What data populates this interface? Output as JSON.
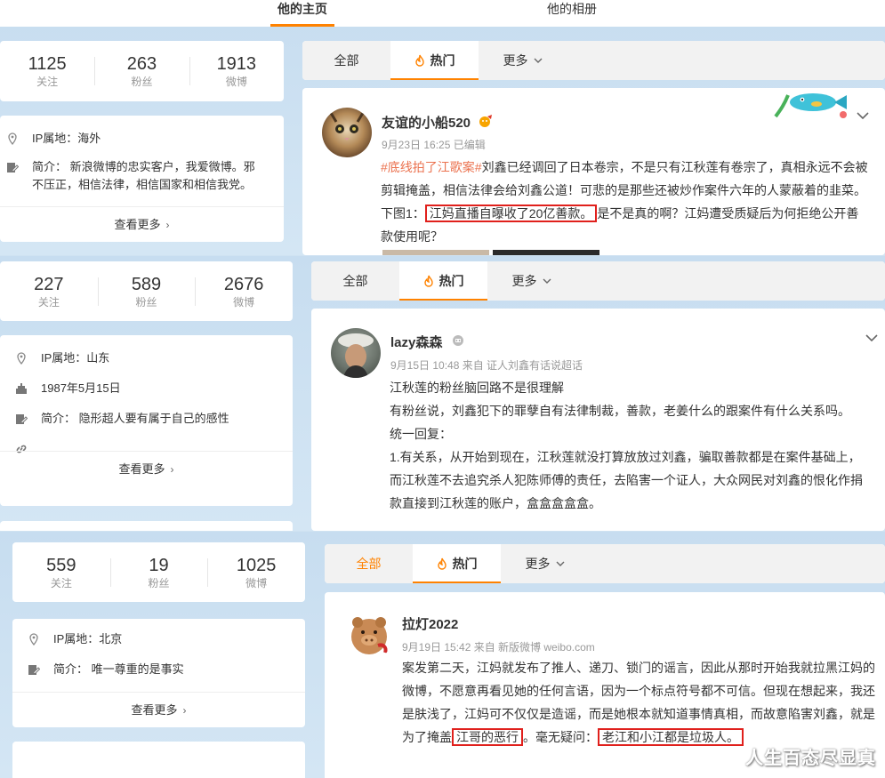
{
  "top_nav": {
    "tabs": [
      "他的主页",
      "他的相册"
    ]
  },
  "tabs": {
    "all": "全部",
    "hot": "热门",
    "more": "更多"
  },
  "more_label": "查看更多",
  "profiles": [
    {
      "stats": [
        {
          "value": "1125",
          "label": "关注"
        },
        {
          "value": "263",
          "label": "粉丝"
        },
        {
          "value": "1913",
          "label": "微博"
        }
      ],
      "ip": "IP属地：海外",
      "intro": "简介：  新浪微博的忠实客户，我爱微博。邪不压正，相信法律，相信国家和相信我党。"
    },
    {
      "stats": [
        {
          "value": "227",
          "label": "关注"
        },
        {
          "value": "589",
          "label": "粉丝"
        },
        {
          "value": "2676",
          "label": "微博"
        }
      ],
      "ip": "IP属地：山东",
      "birthday": "1987年5月15日",
      "intro": "简介：  隐形超人要有属于自己的感性"
    },
    {
      "stats": [
        {
          "value": "559",
          "label": "关注"
        },
        {
          "value": "19",
          "label": "粉丝"
        },
        {
          "value": "1025",
          "label": "微博"
        }
      ],
      "ip": "IP属地：北京",
      "intro": "简介：  唯一尊重的是事实"
    }
  ],
  "posts": [
    {
      "username": "友谊的小船520",
      "meta": "9月23日 16:25   已编辑",
      "tag": "#底线拍了江歌案#",
      "text_a": "刘鑫已经调回了日本卷宗，不是只有江秋莲有卷宗了，真相永远不会被剪辑掩盖，相信法律会给刘鑫公道！可悲的是那些还被炒作案件六年的人蒙蔽着的韭菜。下图1：",
      "highlight": "江妈直播自曝收了20亿善款。",
      "text_b": "是不是真的啊？江妈遭受质疑后为何拒绝公开善款使用呢？"
    },
    {
      "username": "lazy森森",
      "meta": "9月15日 10:48 来自 证人刘鑫有话说超话",
      "lines": [
        "江秋莲的粉丝脑回路不是很理解",
        "有粉丝说，刘鑫犯下的罪孽自有法律制裁，善款，老姜什么的跟案件有什么关系吗。",
        "统一回复：",
        "1.有关系，从开始到现在，江秋莲就没打算放放过刘鑫，骗取善款都是在案件基础上，而江秋莲不去追究杀人犯陈师傅的责任，去陷害一个证人，大众网民对刘鑫的恨化作捐款直接到江秋莲的账户，盒盒盒盒盒。"
      ]
    },
    {
      "username": "拉灯2022",
      "meta": "9月19日 15:42 来自 新版微博 weibo.com",
      "text_a": "案发第二天，江妈就发布了推人、递刀、锁门的谣言，因此从那时开始我就拉黑江妈的微博，不愿意再看见她的任何言语，因为一个标点符号都不可信。但现在想起来，我还是肤浅了，江妈可不仅仅是造谣，而是她根本就知道事情真相，而故意陷害刘鑫，就是为了掩盖",
      "highlight1": "江哥的恶行",
      "text_b": "。毫无疑问：",
      "highlight2": "老江和小江都是垃圾人。"
    }
  ],
  "watermark": "人生百态尽显真"
}
